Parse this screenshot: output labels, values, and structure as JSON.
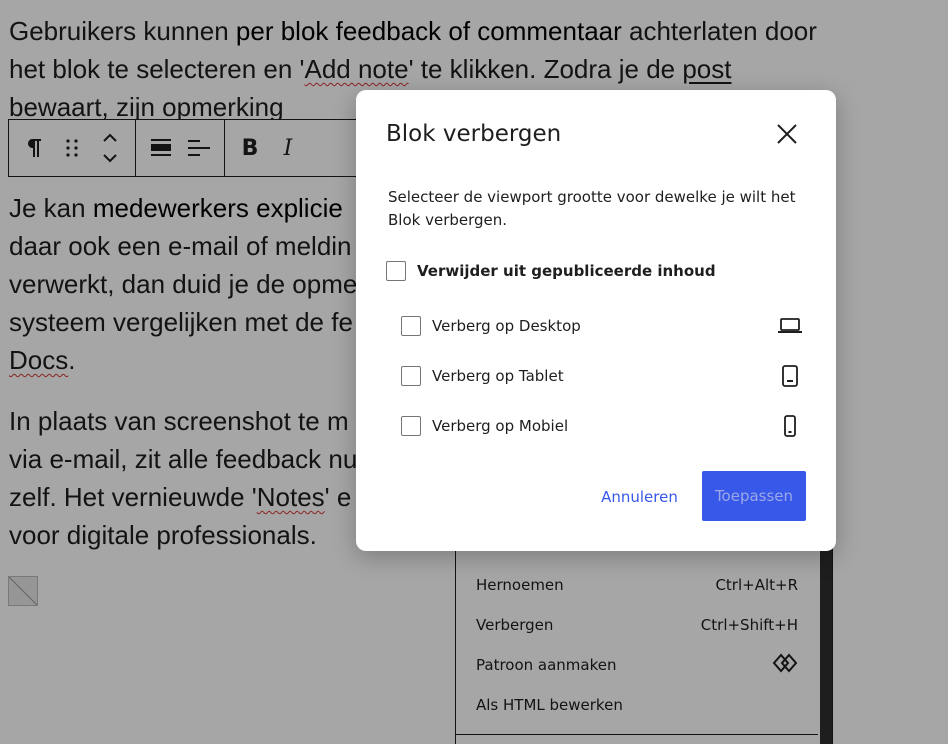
{
  "editor": {
    "paragraph1": {
      "part1": "Gebruikers kunnen ",
      "bold": "per blok feedback of commentaar",
      "part2": " achterlaten door het blok te selecteren en '",
      "add_note": "Add note",
      "part3": "' te klikken. Zodra je de ",
      "part4": "post bewaart, zijn opmerking"
    },
    "paragraph2": {
      "line1a": "Je kan ",
      "line1b": "medewerkers explicie",
      "line2": "daar ook een e-mail of meldin",
      "line3": "verwerkt, dan duid je de opme",
      "line4": "systeem vergelijken met de fe",
      "line5a": "Docs",
      "line5b": "."
    },
    "paragraph3": {
      "line1": "In plaats van screenshot te m",
      "line2": "via e-mail, zit alle feedback nu",
      "line3a": "zelf. Het vernieuwde '",
      "line3b": "Notes",
      "line3c": "' e",
      "line4": "voor digitale professionals."
    },
    "toolbar": {
      "paragraph_icon": "pilcrow-icon",
      "drag_icon": "drag-handle-icon",
      "move_icon": "move-up-down-icon",
      "align_icon": "align-center-icon",
      "text_align_icon": "text-align-left-icon",
      "bold_label": "B",
      "italic_label": "I"
    }
  },
  "context_menu": {
    "items": [
      {
        "label": "Hernoemen",
        "shortcut": "Ctrl+Alt+R"
      },
      {
        "label": "Verbergen",
        "shortcut": "Ctrl+Shift+H"
      },
      {
        "label": "Patroon aanmaken",
        "icon": "pattern-icon"
      },
      {
        "label": "Als HTML bewerken",
        "shortcut": ""
      }
    ]
  },
  "modal": {
    "title": "Blok verbergen",
    "close_icon": "close-icon",
    "description": "Selecteer de viewport grootte voor dewelke je wilt het Blok verbergen.",
    "main_option": {
      "label": "Verwijder uit gepubliceerde inhoud",
      "checked": false
    },
    "options": [
      {
        "label": "Verberg op Desktop",
        "icon": "desktop-icon",
        "checked": false
      },
      {
        "label": "Verberg op Tablet",
        "icon": "tablet-icon",
        "checked": false
      },
      {
        "label": "Verberg op Mobiel",
        "icon": "mobile-icon",
        "checked": false
      }
    ],
    "cancel_label": "Annuleren",
    "apply_label": "Toepassen"
  },
  "colors": {
    "accent": "#3858e9",
    "overlay": "rgba(0,0,0,0.35)",
    "spellcheck": "#d63638"
  }
}
